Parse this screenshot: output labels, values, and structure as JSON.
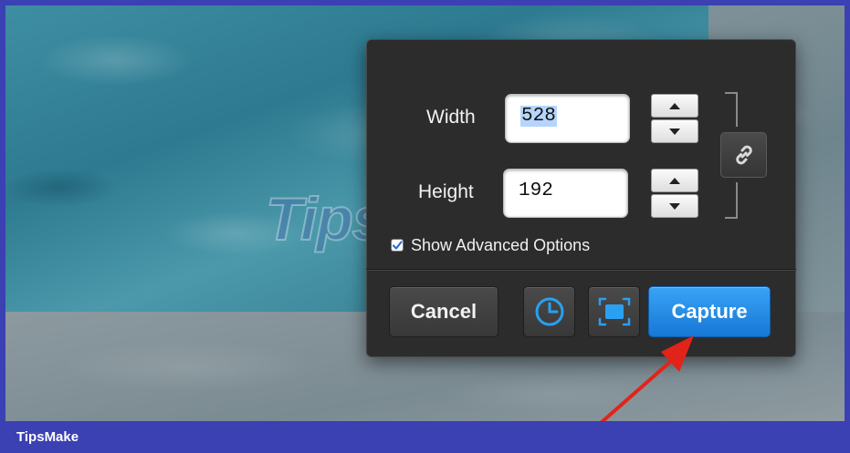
{
  "background": {
    "watermark_text": "TipsMake"
  },
  "dialog": {
    "width_label": "Width",
    "width_value": "528",
    "height_label": "Height",
    "height_value": "192",
    "advanced_options_label": "Show Advanced Options",
    "advanced_options_checked": true,
    "cancel_label": "Cancel",
    "capture_label": "Capture",
    "accent_color": "#1a86e8",
    "icons": [
      "chevron-up-icon",
      "chevron-down-icon",
      "link-icon",
      "timer-icon",
      "fullscreen-icon",
      "checkmark-icon",
      "red-arrow-icon"
    ]
  },
  "footer": {
    "brand": "TipsMake"
  }
}
